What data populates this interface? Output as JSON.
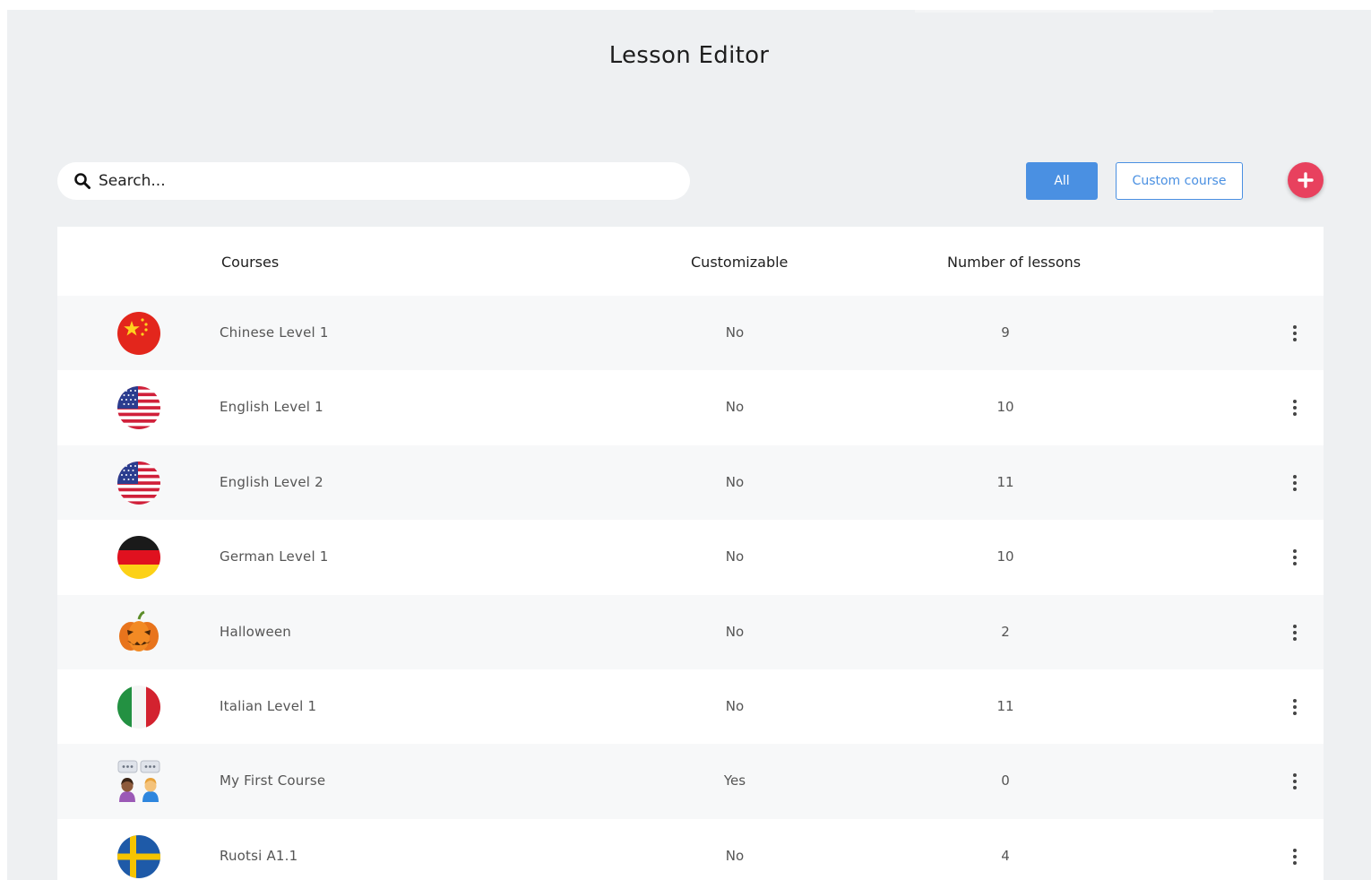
{
  "page": {
    "title": "Lesson Editor"
  },
  "toolbar": {
    "search_placeholder": "Search...",
    "filter_all_label": "All",
    "filter_custom_label": "Custom course",
    "add_icon": "plus-icon"
  },
  "colors": {
    "accent_blue": "#4a90e2",
    "add_button": "#e8415e",
    "background": "#eef0f2"
  },
  "table": {
    "headers": {
      "courses": "Courses",
      "customizable": "Customizable",
      "lessons": "Number of lessons"
    },
    "rows": [
      {
        "icon": "china-flag-icon",
        "name": "Chinese Level 1",
        "customizable": "No",
        "lessons": "9"
      },
      {
        "icon": "usa-flag-icon",
        "name": "English Level 1",
        "customizable": "No",
        "lessons": "10"
      },
      {
        "icon": "usa-flag-icon",
        "name": "English Level 2",
        "customizable": "No",
        "lessons": "11"
      },
      {
        "icon": "germany-flag-icon",
        "name": "German Level 1",
        "customizable": "No",
        "lessons": "10"
      },
      {
        "icon": "pumpkin-icon",
        "name": "Halloween",
        "customizable": "No",
        "lessons": "2"
      },
      {
        "icon": "italy-flag-icon",
        "name": "Italian Level 1",
        "customizable": "No",
        "lessons": "11"
      },
      {
        "icon": "people-talking-icon",
        "name": "My First Course",
        "customizable": "Yes",
        "lessons": "0"
      },
      {
        "icon": "sweden-flag-icon",
        "name": "Ruotsi A1.1",
        "customizable": "No",
        "lessons": "4"
      }
    ]
  }
}
